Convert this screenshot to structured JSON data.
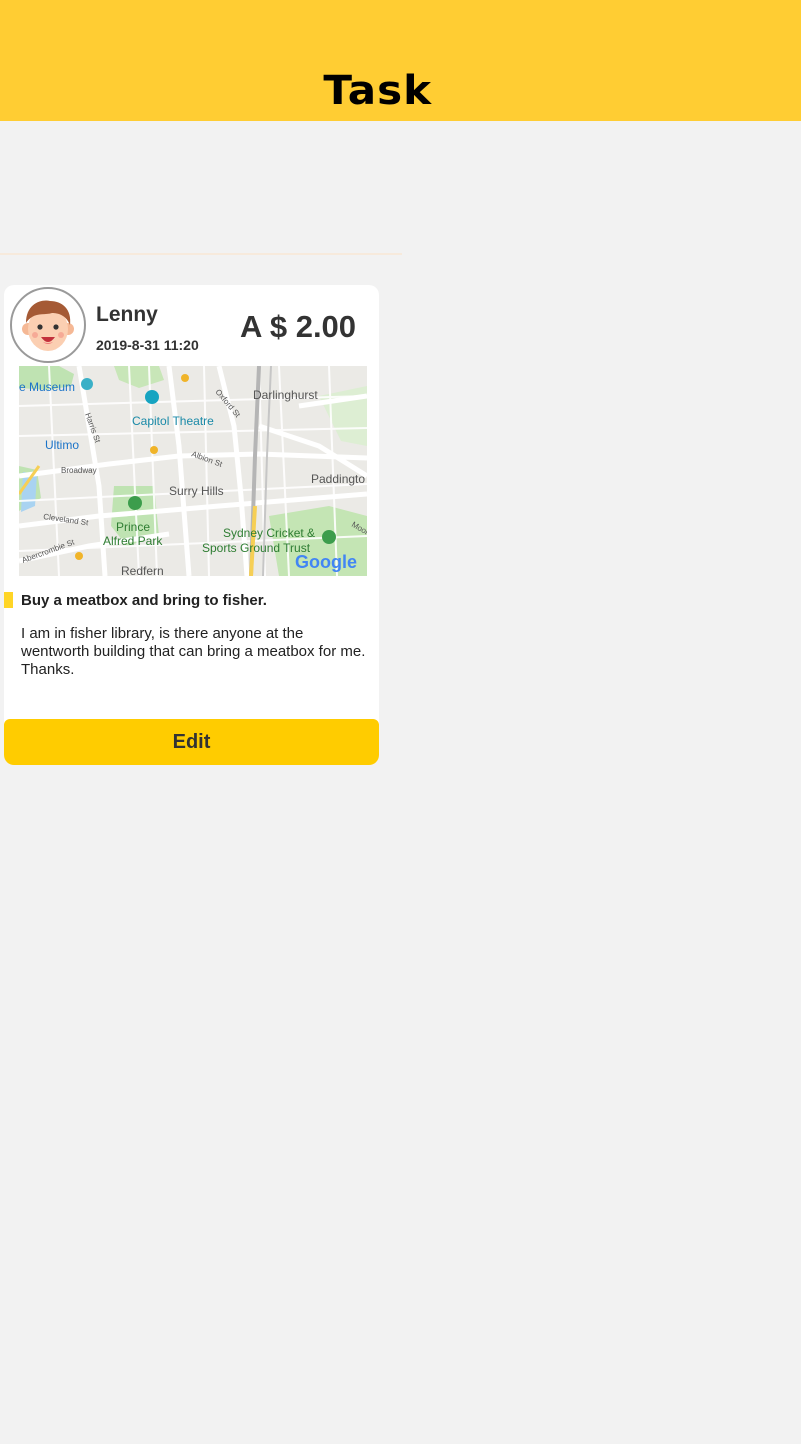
{
  "header": {
    "title": "Task",
    "background": "#ffcd33"
  },
  "task": {
    "user_name": "Lenny",
    "timestamp": "2019-8-31 11:20",
    "price": "A $ 2.00",
    "title": "Buy a meatbox and bring to fisher.",
    "description": "I am in fisher library, is there anyone at the wentworth building that can bring a meatbox for me. Thanks.",
    "avatar_icon": "boy-face-avatar-icon"
  },
  "map": {
    "labels": {
      "museum": "e Museum",
      "darlinghurst": "Darlinghurst",
      "capitol_theatre": "Capitol Theatre",
      "oxford_st": "Oxford St",
      "harris_st": "Harris St",
      "ultimo": "Ultimo",
      "albion_st": "Albion St",
      "broadway": "Broadway",
      "paddington": "Paddingto",
      "surry_hills": "Surry Hills",
      "cleveland_st": "Cleveland St",
      "prince_alfred_line1": "Prince",
      "prince_alfred_line2": "Alfred Park",
      "sydney_cricket_line1": "Sydney Cricket &",
      "sydney_cricket_line2": "Sports Ground Trust",
      "abercrombie_st": "Abercrombie St",
      "redfern": "Redfern",
      "moore": "Moor",
      "google": "Google"
    }
  },
  "actions": {
    "edit_label": "Edit",
    "button_color": "#ffcc00"
  }
}
